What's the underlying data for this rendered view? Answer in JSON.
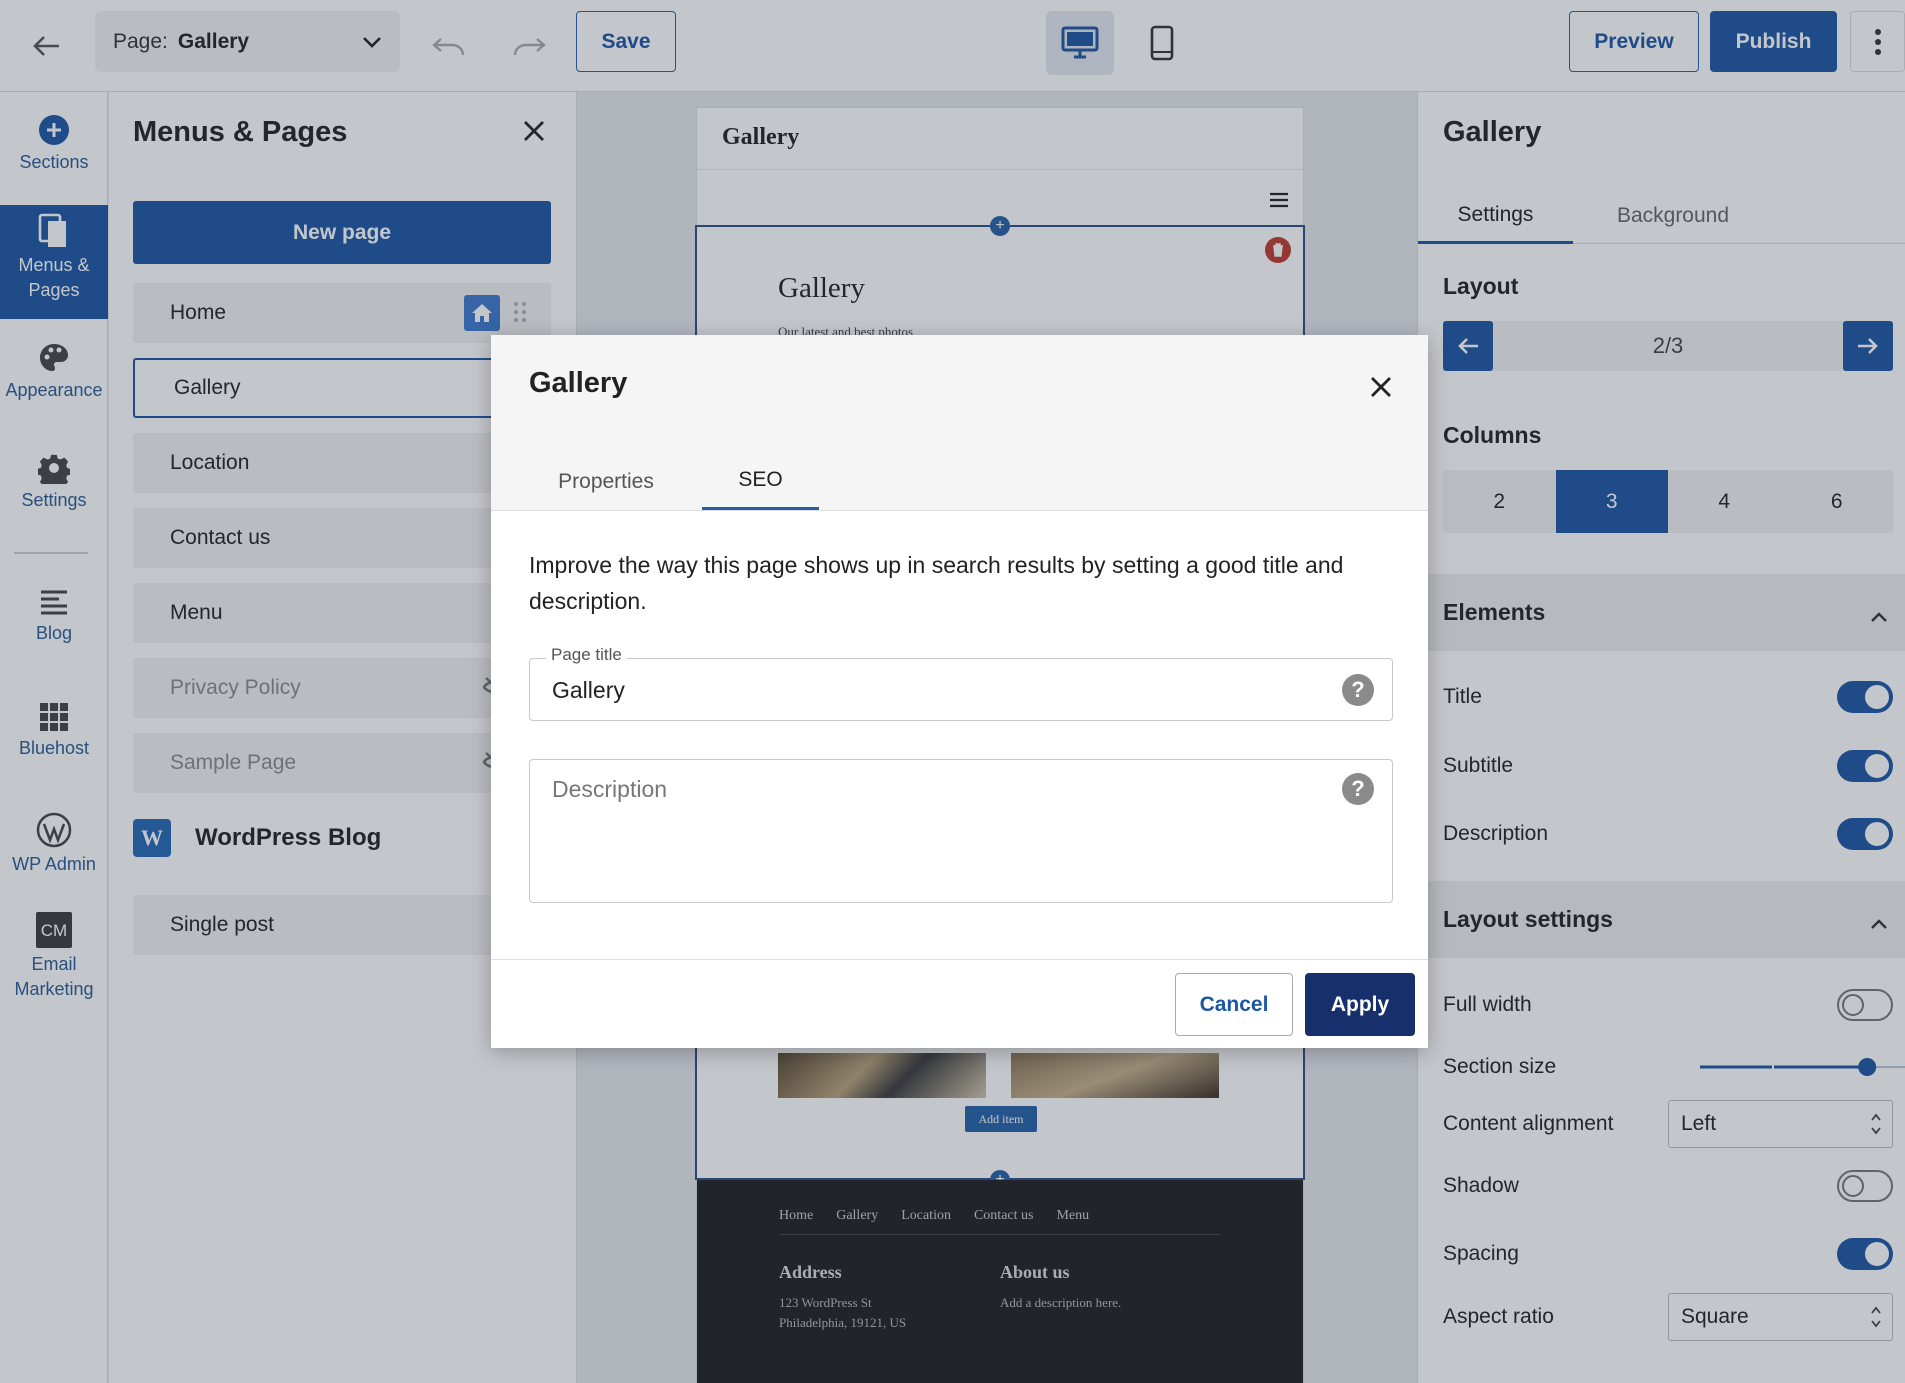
{
  "topbar": {
    "page_label": "Page:",
    "page_value": "Gallery",
    "save_label": "Save",
    "preview_label": "Preview",
    "publish_label": "Publish"
  },
  "rail": {
    "items": [
      {
        "label": "Sections"
      },
      {
        "label": "Menus & Pages"
      },
      {
        "label": "Appearance"
      },
      {
        "label": "Settings"
      },
      {
        "label": "Blog"
      },
      {
        "label": "Bluehost"
      },
      {
        "label": "WP Admin"
      },
      {
        "label": "Email Marketing",
        "icon_text": "CM"
      }
    ]
  },
  "menus_pages": {
    "title": "Menus & Pages",
    "new_page_label": "New page",
    "pages": [
      {
        "label": "Home"
      },
      {
        "label": "Gallery"
      },
      {
        "label": "Location"
      },
      {
        "label": "Contact us"
      },
      {
        "label": "Menu"
      },
      {
        "label": "Privacy Policy"
      },
      {
        "label": "Sample Page"
      }
    ],
    "wp_blog_label": "WordPress Blog",
    "wp_icon_text": "W",
    "single_post_label": "Single post"
  },
  "site": {
    "header_title": "Gallery",
    "section_title": "Gallery",
    "section_subtitle": "Our latest and best photos",
    "add_item_label": "Add item",
    "footer_nav": [
      "Home",
      "Gallery",
      "Location",
      "Contact us",
      "Menu"
    ],
    "footer_address_heading": "Address",
    "footer_address_lines": [
      "123 WordPress St",
      "Philadelphia, 19121, US"
    ],
    "footer_about_heading": "About us",
    "footer_about_text": "Add a description here."
  },
  "settings": {
    "title": "Gallery",
    "tabs": [
      "Settings",
      "Background"
    ],
    "layout_heading": "Layout",
    "layout_value": "2/3",
    "columns_heading": "Columns",
    "columns": [
      "2",
      "3",
      "4",
      "6"
    ],
    "columns_selected": "3",
    "elements_heading": "Elements",
    "elements": [
      {
        "label": "Title",
        "on": true
      },
      {
        "label": "Subtitle",
        "on": true
      },
      {
        "label": "Description",
        "on": true
      }
    ],
    "layout_settings_heading": "Layout settings",
    "full_width_label": "Full width",
    "full_width_on": false,
    "section_size_label": "Section size",
    "section_size_value": 0.76,
    "content_alignment_label": "Content alignment",
    "content_alignment_value": "Left",
    "shadow_label": "Shadow",
    "shadow_on": false,
    "spacing_label": "Spacing",
    "spacing_on": true,
    "aspect_ratio_label": "Aspect ratio",
    "aspect_ratio_value": "Square"
  },
  "dialog": {
    "title": "Gallery",
    "tabs": [
      "Properties",
      "SEO"
    ],
    "active_tab": "SEO",
    "intro": "Improve the way this page shows up in search results by setting a good title and description.",
    "page_title_label": "Page title",
    "page_title_value": "Gallery",
    "description_placeholder": "Description",
    "help_glyph": "?",
    "cancel_label": "Cancel",
    "apply_label": "Apply"
  },
  "colors": {
    "primary": "#1c57a3",
    "apply": "#17306b",
    "danger": "#c0392b"
  }
}
